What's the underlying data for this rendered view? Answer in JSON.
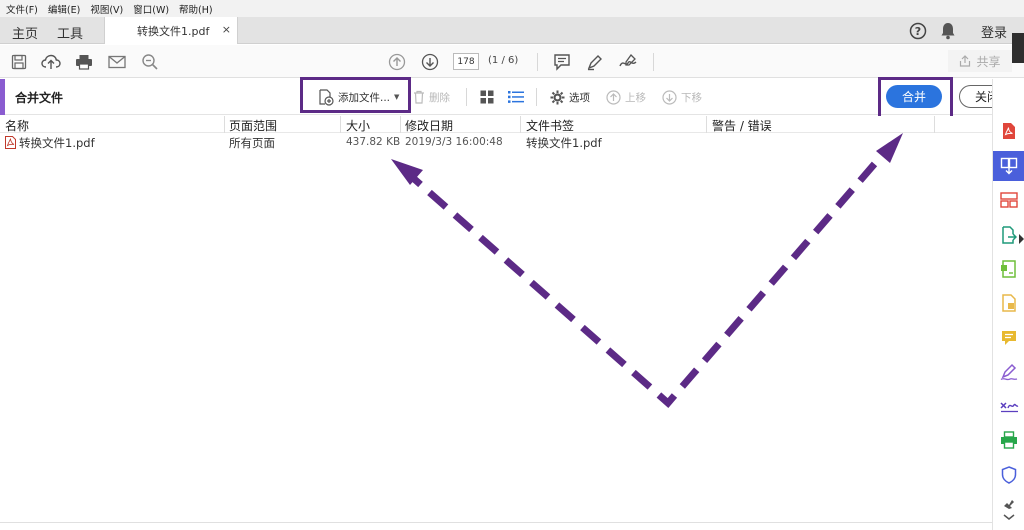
{
  "menu": [
    "文件(F)",
    "编辑(E)",
    "视图(V)",
    "窗口(W)",
    "帮助(H)"
  ],
  "tabs": {
    "home": "主页",
    "tools": "工具",
    "document": "转换文件1.pdf",
    "close": "×"
  },
  "account": {
    "login": "登录",
    "help_icon": "help-circle-icon",
    "bell_icon": "bell-icon"
  },
  "toolbar": {
    "page_number": "178",
    "page_count": "(1 / 6)",
    "share": "共享"
  },
  "combine": {
    "title": "合并文件",
    "add_files": "添加文件...",
    "delete": "删除",
    "options": "选项",
    "move_up": "上移",
    "move_down": "下移",
    "merge": "合并",
    "close": "关闭"
  },
  "file_list": {
    "columns": [
      "名称",
      "页面范围",
      "大小",
      "修改日期",
      "文件书签",
      "警告 / 错误"
    ],
    "rows": [
      {
        "name": "转换文件1.pdf",
        "pages": "所有页面",
        "size": "437.82 KB",
        "modified": "2019/3/3 16:00:48",
        "bookmark": "转换文件1.pdf",
        "warning": ""
      }
    ]
  },
  "colors": {
    "accent": "#8a5cd0",
    "merge_button": "#2b74de",
    "highlight": "#5c2a86",
    "annotation_arrow": "#5c2a86",
    "active_tool": "#4a5fdb"
  }
}
